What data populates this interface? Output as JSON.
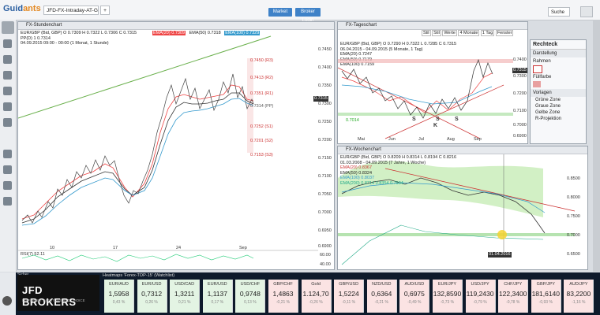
{
  "app": {
    "logo_a": "Guid",
    "logo_b": "ants"
  },
  "tabs": [
    {
      "label": "JFD-FX-Intraday-AT-G-W"
    }
  ],
  "topbar": {
    "btn1": "Market",
    "btn2": "Broker Login",
    "search": "Suche"
  },
  "panel1": {
    "title": "FX-Stundenchart",
    "legend": [
      "EUR/GBP (Bid, GBP) O 0.7309 H 0.7322 L 0.7306 C 0.7315",
      "PP(D) 1 0.7314",
      "04.09.2015 09:00 - 00:00 (1 Monat, 1 Stunde)"
    ],
    "ema_legend": [
      "EMA(20) 0.7309",
      "EMA(50) 0.7318",
      "EMA(100) 0.7329"
    ],
    "levels": [
      "0.7450 (R3)",
      "0.7413 (R2)",
      "0.7351 (R1)",
      "0.7314 (PP)",
      "0.7252 (S1)",
      "0.7201 (S2)",
      "0.7153 (S3)"
    ],
    "yticks": [
      "0.7450",
      "0.7400",
      "0.7350",
      "0.7300",
      "0.7250",
      "0.7200",
      "0.7150",
      "0.7100",
      "0.7050",
      "0.7000",
      "0.6950",
      "0.6900"
    ],
    "xticks": [
      "10",
      "17",
      "24",
      "Sep"
    ],
    "rsi_label": "RSI(7) 52.11",
    "rsi_ticks": [
      "60.00",
      "40.00"
    ]
  },
  "panel2": {
    "title": "FX-Tageschart",
    "toolbar": [
      "Stil",
      "Stil",
      "Werte",
      "Stil",
      "4 Monate",
      "1 Tag",
      "Fenster"
    ],
    "legend": [
      "06.04.2015 - 04.09.2015 (5 Monate, 1 Tag)",
      "EMA(20) 0.7247",
      "EMA(50) 0.7179",
      "EMA(100) 0.7159"
    ],
    "ohlc": "EUR/GBP (Bid, GBP) O 0.7290 H 0.7322 L 0.7285 C 0.7315",
    "yticks": [
      "0.7400",
      "0.7300",
      "0.7200",
      "0.7100",
      "0.7000",
      "0.6900"
    ],
    "xticks": [
      "Mai",
      "Jun",
      "Jul",
      "Aug",
      "Sep"
    ],
    "labels": [
      "S",
      "K",
      "S",
      "S"
    ],
    "sideline": "0.7014"
  },
  "panel3": {
    "title": "FX-Wochenchart",
    "legend": [
      "EUR/GBP (Bid, GBP) O 0.8209 H 0.8314 L 0.8194 C 0.8216",
      "01.03.2008 - 04.09.2015 (7 Jahre, 1 Woche)",
      "EMA(20) 0.8367",
      "EMA(50) 0.8324",
      "EMA(100) 0.8037",
      "EMA(200) 0.8714 0.8354 0.7904"
    ],
    "yticks": [
      "0.8500",
      "0.8000",
      "0.7500",
      "0.7000",
      "0.6500"
    ],
    "date_tag": "01.04.2016"
  },
  "side": {
    "header": "Rechteck",
    "section1": "Darstellung",
    "rahmen": "Rahmen",
    "fuellfarbe": "Füllfarbe",
    "vorlagen": "Vorlagen",
    "items": [
      "Grüne Zone",
      "Graue Zone",
      "Gelbe Zone",
      "R-Projektion"
    ]
  },
  "bottom": {
    "brand": "JFD BROKERS",
    "brand_sub": "DIFFERENT IN FUTURE AND CHOICE",
    "heatmap_title": "Heatmaps 'Forex-TOP-15' (Watchlist)",
    "sicher": "Sicher"
  },
  "tickers": [
    {
      "n": "EUR/AUD",
      "v": "1,5958",
      "c": "0,43 %"
    },
    {
      "n": "EUR/USD",
      "v": "0,7312",
      "c": "0,26 %"
    },
    {
      "n": "USD/CAD",
      "v": "1,3211",
      "c": "0,21 %"
    },
    {
      "n": "EUR/USD",
      "v": "1,1137",
      "c": "0,17 %"
    },
    {
      "n": "USD/CHF",
      "v": "0,9748",
      "c": "0,13 %"
    },
    {
      "n": "GBP/CHF",
      "v": "1,4863",
      "c": "-0,21 %"
    },
    {
      "n": "Gold",
      "v": "1.124,70",
      "c": "-0,26 %"
    },
    {
      "n": "GBP/USD",
      "v": "1,5224",
      "c": "-0,11 %"
    },
    {
      "n": "NZD/USD",
      "v": "0,6364",
      "c": "-0,21 %"
    },
    {
      "n": "AUD/USD",
      "v": "0,6975",
      "c": "-0,49 %"
    },
    {
      "n": "EUR/JPY",
      "v": "132,8590",
      "c": "-0,73 %"
    },
    {
      "n": "USD/JPY",
      "v": "119,2430",
      "c": "-0,79 %"
    },
    {
      "n": "CHF/JPY",
      "v": "122,3400",
      "c": "-0,78 %"
    },
    {
      "n": "GBP/JPY",
      "v": "181,6140",
      "c": "-0,93 %"
    },
    {
      "n": "AUD/JPY",
      "v": "83,2200",
      "c": "-1,16 %"
    }
  ]
}
